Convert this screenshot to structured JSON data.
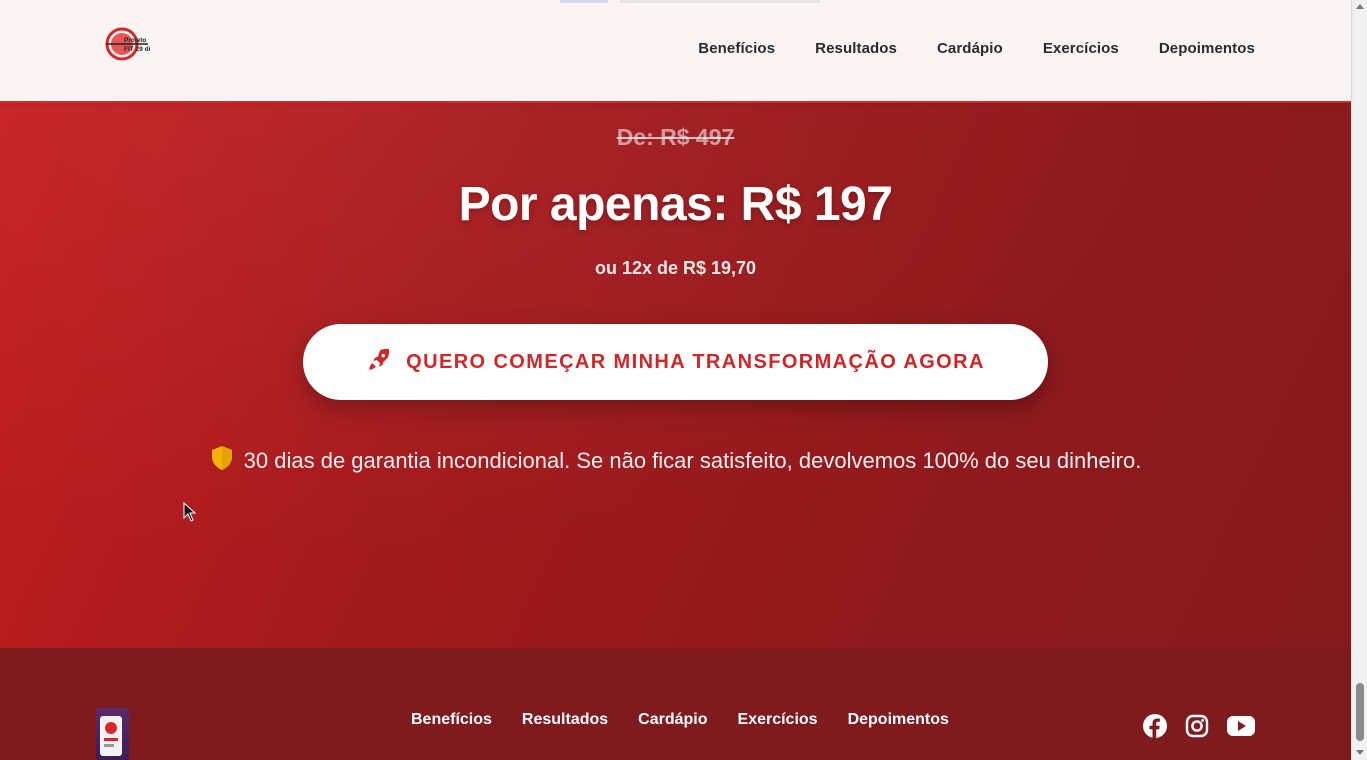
{
  "header": {
    "logo_icon": "projeto-fit-logo",
    "logo_text": "Projeto FIT 29 dias",
    "nav": [
      {
        "label": "Benefícios"
      },
      {
        "label": "Resultados"
      },
      {
        "label": "Cardápio"
      },
      {
        "label": "Exercícios"
      },
      {
        "label": "Depoimentos"
      }
    ]
  },
  "offer": {
    "old_price": "De: R$ 497",
    "new_price": "Por apenas: R$ 197",
    "installments": "ou 12x de R$ 19,70",
    "cta_label": "QUERO COMEÇAR MINHA TRANSFORMAÇÃO AGORA",
    "cta_icon": "rocket-icon",
    "guarantee_icon": "shield-icon",
    "guarantee_text": "30 dias de garantia incondicional. Se não ficar satisfeito, devolvemos 100% do seu dinheiro."
  },
  "footer": {
    "nav": [
      {
        "label": "Benefícios"
      },
      {
        "label": "Resultados"
      },
      {
        "label": "Cardápio"
      },
      {
        "label": "Exercícios"
      },
      {
        "label": "Depoimentos"
      }
    ],
    "social": [
      "facebook-icon",
      "instagram-icon",
      "youtube-icon"
    ]
  },
  "colors": {
    "brand_red": "#cf2326",
    "section_bg_start": "#c61d1f",
    "section_bg_end": "#861a1c",
    "footer_bg": "#7e1b1e",
    "shield_yellow": "#f5b301"
  }
}
